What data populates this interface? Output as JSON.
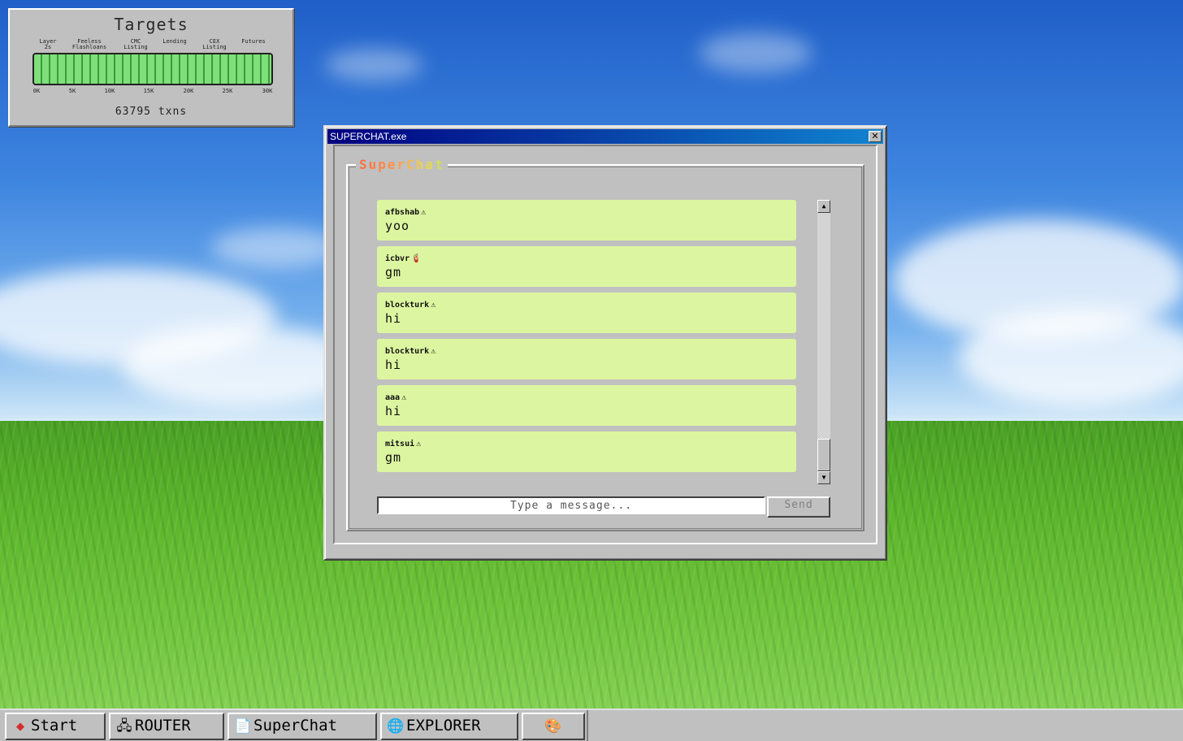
{
  "targets": {
    "title": "Targets",
    "milestones": [
      "Layer\n2s",
      "Feeless\nFlashloans",
      "CMC\nListing",
      "Lending",
      "CEX\nListing",
      "Futures"
    ],
    "ticks": [
      "0K",
      "5K",
      "10K",
      "15K",
      "20K",
      "25K",
      "30K"
    ],
    "progress_fraction": 1.0,
    "count_text": "63795 txns"
  },
  "window": {
    "title": "SUPERCHAT.exe",
    "close_label": "✕",
    "app_name": "SuperChat",
    "messages": [
      {
        "user": "afbshab",
        "icon": "⚠",
        "text": "yoo"
      },
      {
        "user": "icbvr",
        "icon": "🧯",
        "text": "gm"
      },
      {
        "user": "blockturk",
        "icon": "⚠",
        "text": "hi"
      },
      {
        "user": "blockturk",
        "icon": "⚠",
        "text": "hi"
      },
      {
        "user": "aaa",
        "icon": "⚠",
        "text": "hi"
      },
      {
        "user": "mitsui",
        "icon": "⚠",
        "text": "gm"
      }
    ],
    "input_placeholder": "Type a message...",
    "send_label": "Send",
    "scroll_up": "▲",
    "scroll_down": "▼"
  },
  "taskbar": {
    "items": [
      {
        "label": "Start",
        "icon": "◆"
      },
      {
        "label": "ROUTER",
        "icon": "🖧"
      },
      {
        "label": "SuperChat",
        "icon": "📄"
      },
      {
        "label": "EXPLORER",
        "icon": "🌐"
      },
      {
        "label": "",
        "icon": "🎨"
      }
    ]
  },
  "colors": {
    "window_bg": "#c0c0c0",
    "title_start": "#000080",
    "message_bg": "#dcf5a0",
    "progress_green": "#7ee07a"
  }
}
